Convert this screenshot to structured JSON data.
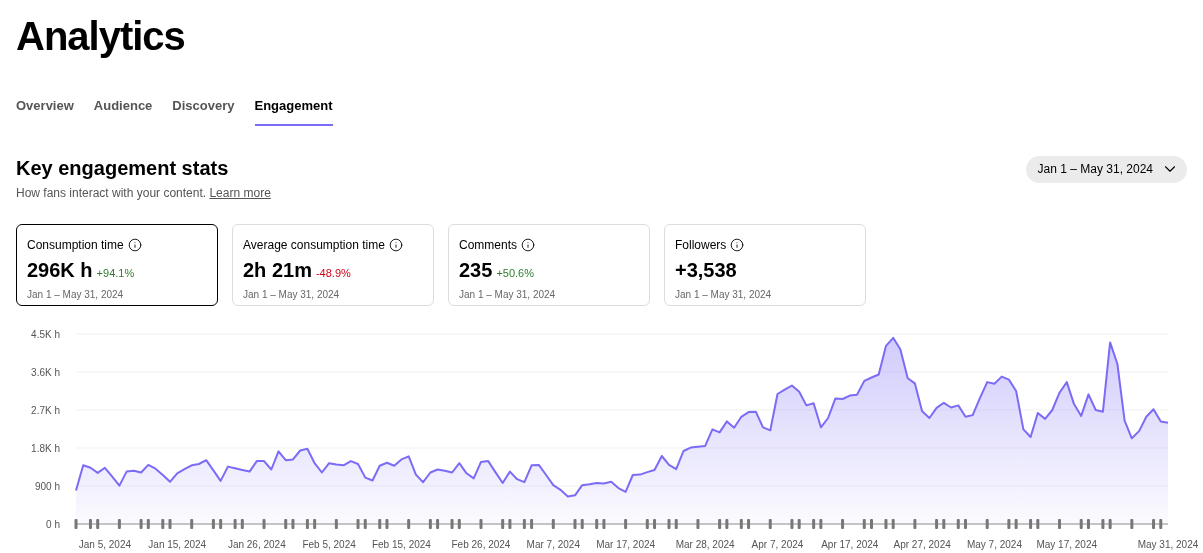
{
  "page_title": "Analytics",
  "tabs": [
    {
      "label": "Overview",
      "selected": false
    },
    {
      "label": "Audience",
      "selected": false
    },
    {
      "label": "Discovery",
      "selected": false
    },
    {
      "label": "Engagement",
      "selected": true
    }
  ],
  "section": {
    "title": "Key engagement stats",
    "subtitle": "How fans interact with your content.",
    "link": "Learn more",
    "date_range": "Jan 1 – May 31, 2024"
  },
  "cards": [
    {
      "label": "Consumption time",
      "value": "296K h",
      "change": {
        "text": "+94.1%",
        "color": "#2e7d32"
      },
      "period": "Jan 1 – May 31, 2024",
      "selected": true
    },
    {
      "label": "Average consumption time",
      "value": "2h 21m",
      "change": {
        "text": "-48.9%",
        "color": "#d0021b"
      },
      "period": "Jan 1 – May 31, 2024",
      "selected": false
    },
    {
      "label": "Comments",
      "value": "235",
      "change": {
        "text": "+50.6%",
        "color": "#2e7d32"
      },
      "period": "Jan 1 – May 31, 2024",
      "selected": false
    },
    {
      "label": "Followers",
      "value": "+3,538",
      "period": "Jan 1 – May 31, 2024",
      "selected": false
    }
  ],
  "chart_data": {
    "type": "area",
    "grid": true,
    "ylim": [
      0,
      4500
    ],
    "yticks": [
      {
        "value": 0,
        "label": "0 h"
      },
      {
        "value": 900,
        "label": "900 h"
      },
      {
        "value": 1800,
        "label": "1.8K h"
      },
      {
        "value": 2700,
        "label": "2.7K h"
      },
      {
        "value": 3600,
        "label": "3.6K h"
      },
      {
        "value": 4500,
        "label": "4.5K h"
      }
    ],
    "categories": [
      null,
      null,
      null,
      null,
      "Jan 5, 2024",
      null,
      null,
      null,
      null,
      null,
      null,
      null,
      null,
      null,
      "Jan 15, 2024",
      null,
      null,
      null,
      null,
      null,
      null,
      null,
      null,
      null,
      null,
      "Jan 26, 2024",
      null,
      null,
      null,
      null,
      null,
      null,
      null,
      null,
      null,
      "Feb 5, 2024",
      null,
      null,
      null,
      null,
      null,
      null,
      null,
      null,
      null,
      "Feb 15, 2024",
      null,
      null,
      null,
      null,
      null,
      null,
      null,
      null,
      null,
      null,
      "Feb 26, 2024",
      null,
      null,
      null,
      null,
      null,
      null,
      null,
      null,
      null,
      "Mar 7, 2024",
      null,
      null,
      null,
      null,
      null,
      null,
      null,
      null,
      null,
      "Mar 17, 2024",
      null,
      null,
      null,
      null,
      null,
      null,
      null,
      null,
      null,
      null,
      "Mar 28, 2024",
      null,
      null,
      null,
      null,
      null,
      null,
      null,
      null,
      null,
      "Apr 7, 2024",
      null,
      null,
      null,
      null,
      null,
      null,
      null,
      null,
      null,
      "Apr 17, 2024",
      null,
      null,
      null,
      null,
      null,
      null,
      null,
      null,
      null,
      "Apr 27, 2024",
      null,
      null,
      null,
      null,
      null,
      null,
      null,
      null,
      null,
      "May 7, 2024",
      null,
      null,
      null,
      null,
      null,
      null,
      null,
      null,
      null,
      "May 17, 2024",
      null,
      null,
      null,
      null,
      null,
      null,
      null,
      null,
      null,
      null,
      null,
      null,
      null,
      "May 31, 2024"
    ],
    "series": [
      {
        "color": "#7b6cf6",
        "values": [
          790,
          1390,
          1330,
          1210,
          1330,
          1120,
          910,
          1240,
          1260,
          1220,
          1400,
          1310,
          1160,
          1000,
          1200,
          1300,
          1390,
          1420,
          1510,
          1270,
          1020,
          1360,
          1320,
          1280,
          1240,
          1490,
          1490,
          1290,
          1720,
          1510,
          1530,
          1740,
          1780,
          1440,
          1220,
          1440,
          1410,
          1390,
          1490,
          1420,
          1100,
          1030,
          1380,
          1450,
          1380,
          1530,
          1600,
          1170,
          990,
          1220,
          1290,
          1260,
          1220,
          1440,
          1200,
          1080,
          1470,
          1490,
          1230,
          970,
          1240,
          1060,
          990,
          1390,
          1400,
          1160,
          920,
          810,
          650,
          680,
          920,
          940,
          970,
          960,
          1000,
          850,
          760,
          1160,
          1170,
          1230,
          1280,
          1610,
          1400,
          1300,
          1730,
          1810,
          1830,
          1850,
          2240,
          2170,
          2430,
          2280,
          2540,
          2650,
          2660,
          2290,
          2220,
          3080,
          3180,
          3280,
          3130,
          2810,
          2860,
          2290,
          2510,
          2970,
          2960,
          3040,
          3060,
          3390,
          3470,
          3540,
          4220,
          4410,
          4130,
          3450,
          3330,
          2670,
          2510,
          2750,
          2870,
          2760,
          2810,
          2540,
          2580,
          2990,
          3360,
          3320,
          3490,
          3420,
          3150,
          2240,
          2060,
          2630,
          2490,
          2700,
          3110,
          3360,
          2840,
          2560,
          3070,
          2700,
          2660,
          4300,
          3790,
          2450,
          2030,
          2200,
          2540,
          2720,
          2430,
          2400
        ]
      }
    ]
  }
}
